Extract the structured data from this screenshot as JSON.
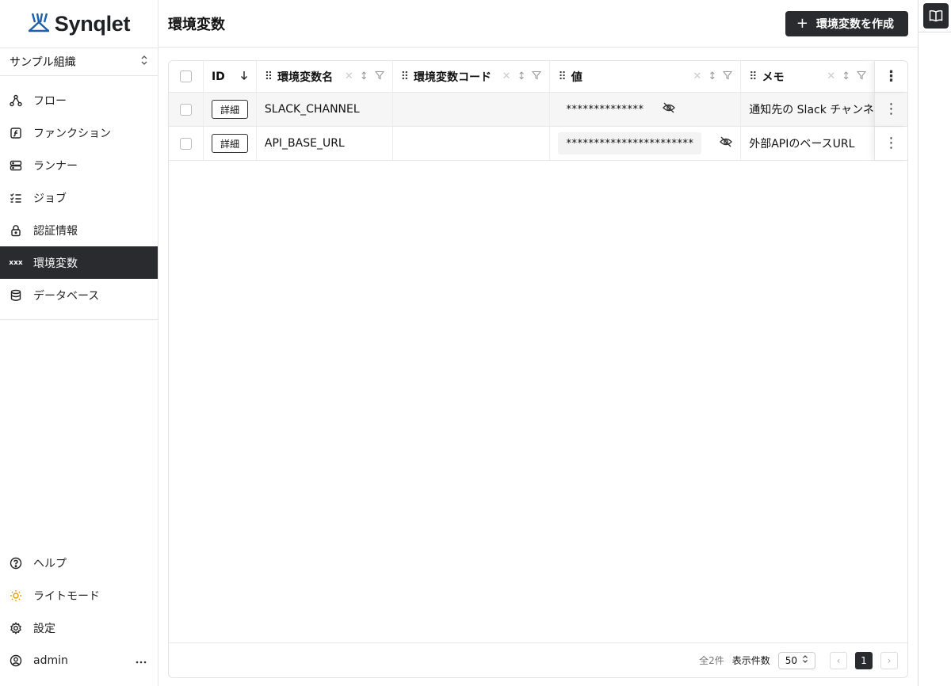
{
  "brand": {
    "name": "Synqlet"
  },
  "org_selector": {
    "value": "サンプル組織"
  },
  "sidebar": {
    "items": [
      {
        "label": "フロー",
        "icon": "flow-icon"
      },
      {
        "label": "ファンクション",
        "icon": "function-icon"
      },
      {
        "label": "ランナー",
        "icon": "server-icon"
      },
      {
        "label": "ジョブ",
        "icon": "checklist-icon"
      },
      {
        "label": "認証情報",
        "icon": "lock-icon"
      },
      {
        "label": "環境変数",
        "icon": "variable-icon",
        "icon_text": "xxx",
        "active": true
      },
      {
        "label": "データベース",
        "icon": "database-icon"
      }
    ],
    "bottom": [
      {
        "label": "ヘルプ",
        "icon": "help-icon"
      },
      {
        "label": "ライトモード",
        "icon": "sun-icon"
      },
      {
        "label": "設定",
        "icon": "gear-icon"
      },
      {
        "label": "admin",
        "icon": "user-icon"
      }
    ]
  },
  "header": {
    "title": "環境変数",
    "create_label": "環境変数を作成"
  },
  "table": {
    "columns": [
      "ID",
      "環境変数名",
      "環境変数コード",
      "値",
      "メモ"
    ],
    "rows": [
      {
        "detail": "詳細",
        "name": "SLACK_CHANNEL",
        "code": "",
        "value": "**************",
        "memo": "通知先の Slack チャンネル"
      },
      {
        "detail": "詳細",
        "name": "API_BASE_URL",
        "code": "",
        "value": "***********************",
        "memo": "外部APIのベースURL"
      }
    ]
  },
  "footer": {
    "total": "全2件",
    "per_page_label": "表示件数",
    "per_page": "50",
    "current_page": "1"
  },
  "colors": {
    "accent": "#2a2b2e",
    "logo_blue": "#1f5fa8"
  }
}
